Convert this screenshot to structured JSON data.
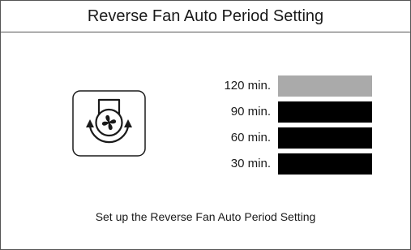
{
  "title": "Reverse Fan Auto Period Setting",
  "icon": "reverse-fan-icon",
  "options": [
    {
      "label": "120  min.",
      "selected": true
    },
    {
      "label": "90  min.",
      "selected": false
    },
    {
      "label": "60  min.",
      "selected": false
    },
    {
      "label": "30  min.",
      "selected": false
    }
  ],
  "colors": {
    "selected_bar": "#aaaaaa",
    "unselected_bar": "#000000"
  },
  "instruction": "Set up the Reverse Fan Auto Period Setting"
}
